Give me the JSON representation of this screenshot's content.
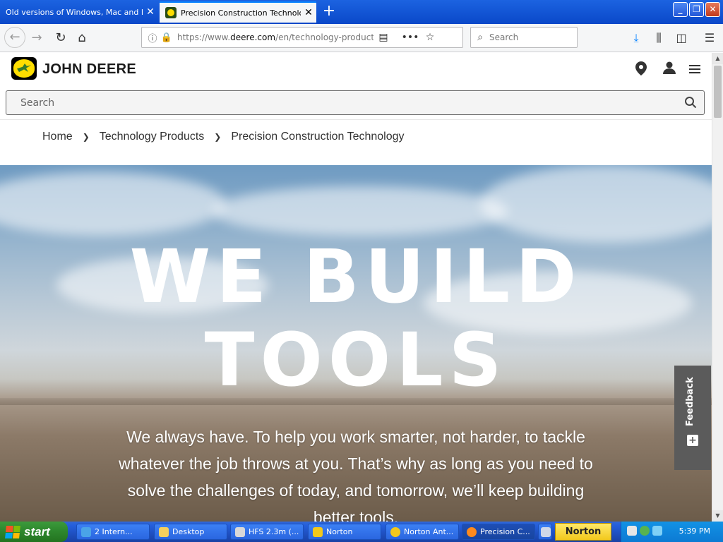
{
  "browser": {
    "tabs": [
      {
        "title": "Old versions of Windows, Mac and Linu",
        "active": false
      },
      {
        "title": "Precision Construction Technology",
        "active": true
      }
    ],
    "url_prefix": "https://www.",
    "url_domain": "deere.com",
    "url_rest": "/en/technology-products",
    "search_placeholder": "Search"
  },
  "site": {
    "brand": "JOHN DEERE",
    "search_placeholder": "Search",
    "breadcrumb": [
      "Home",
      "Technology Products",
      "Precision Construction Technology"
    ]
  },
  "hero": {
    "title_line1": "WE BUILD",
    "title_line2": "TOOLS",
    "copy": "We always have. To help you work smarter, not harder, to tackle whatever the job throws at you. That’s why as long as you need to solve the challenges of today, and tomorrow, we’ll keep building better tools."
  },
  "feedback_label": "Feedback",
  "taskbar": {
    "start_label": "start",
    "buttons": [
      "2 Intern...",
      "Desktop",
      "HFS 2.3m (...",
      "Norton",
      "Norton Ant...",
      "Precision C..."
    ],
    "norton_label": "Norton",
    "clock": "5:39 PM"
  },
  "colors": {
    "deere_green": "#367c2b",
    "deere_yellow": "#ffde00",
    "titlebar_blue": "#0a48c9",
    "taskbar_blue": "#245edb",
    "start_green": "#2f8a2f"
  }
}
